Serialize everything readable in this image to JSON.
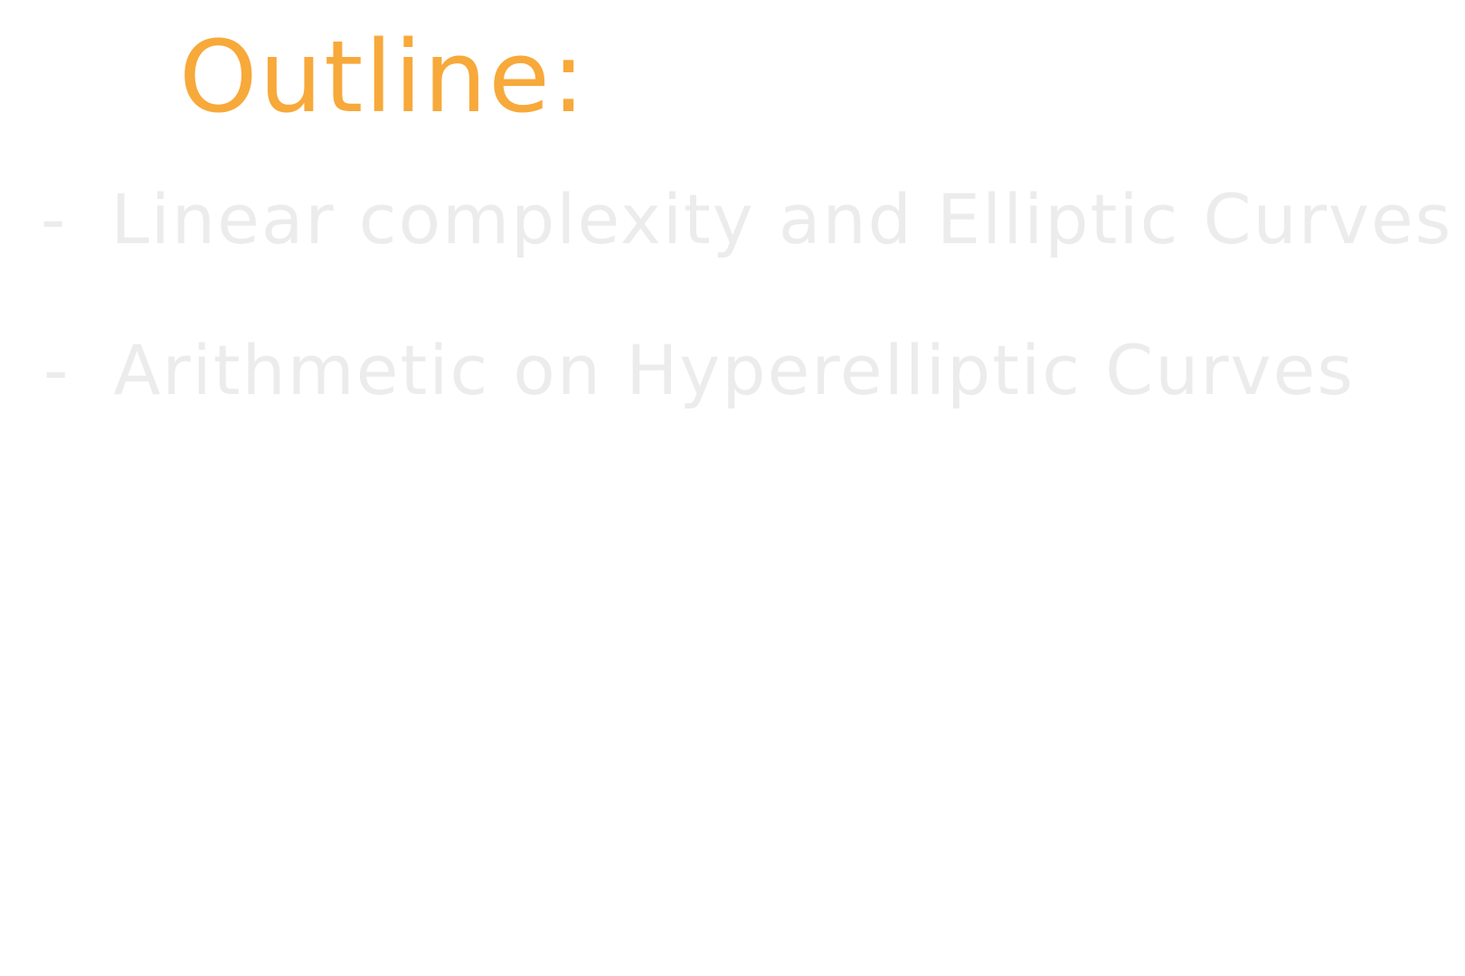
{
  "slide": {
    "title": "Outline:",
    "items": [
      {
        "bullet": "-",
        "text": "Linear complexity and Elliptic Curves"
      },
      {
        "bullet": "-",
        "text": "Arithmetic on Hyperelliptic Curves"
      }
    ]
  },
  "colors": {
    "background": "#ffffff",
    "title": "#f7a93a",
    "items": "#ececec"
  }
}
